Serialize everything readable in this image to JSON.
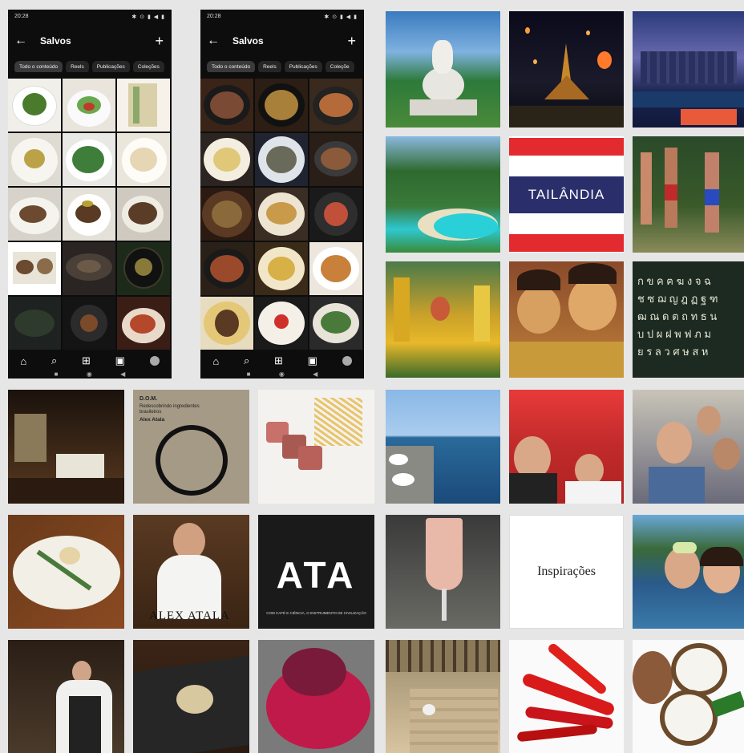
{
  "phones": [
    {
      "status_time": "20:28",
      "status_icons": "✱ ⊙ ▮ ◀ ▮",
      "title": "Salvos",
      "back_icon": "arrow-left-icon",
      "plus_icon": "plus-icon",
      "chips": [
        "Todo o conteúdo",
        "Reels",
        "Publicações",
        "Coleções"
      ],
      "nav_icons": [
        "home-icon",
        "search-icon",
        "add-post-icon",
        "reels-icon",
        "profile-avatar"
      ],
      "system_nav_icons": [
        "square-icon",
        "circle-icon",
        "triangle-back-icon"
      ]
    },
    {
      "status_time": "20:28",
      "status_icons": "✱ ⊙ ▮ ◀ ▮",
      "title": "Salvos",
      "back_icon": "arrow-left-icon",
      "plus_icon": "plus-icon",
      "chips": [
        "Todo o conteúdo",
        "Reels",
        "Publicações",
        "Coleçõe"
      ],
      "nav_icons": [
        "home-icon",
        "search-icon",
        "add-post-icon",
        "reels-icon",
        "profile-avatar"
      ],
      "system_nav_icons": [
        "square-icon",
        "circle-icon",
        "triangle-back-icon"
      ]
    }
  ],
  "thailand_banner": "TAILÂNDIA",
  "thai_letters_rows": [
    "ก ข ค ฅ ฆ ง จ ฉ",
    "ช ซ ฌ ญ ฎ ฏ ฐ ฑ",
    "ฒ ณ ด ต ถ ท ธ น",
    "บ ป ผ ฝ พ ฟ ภ ม",
    "ย ร ล ว ศ ษ ส ห"
  ],
  "book_cover": {
    "title": "D.O.M.",
    "subtitle": "Redescobrindo ingredientes brasileiros",
    "author": "Alex Atala"
  },
  "chef_poster_text": "ALEX ATALA",
  "ata_logo_text": "ATA",
  "ata_caption": "COM CAFÉ E CIÊNCIA, O INSTRUMENTO DE CIVILIZAÇÃO",
  "inspiracoes_label": "Inspirações",
  "palette": {
    "phone_bg": "#0d0d0d",
    "thai_red": "#e32b2f",
    "thai_blue": "#2a2f6b",
    "gutter": "#e6e6e6"
  }
}
